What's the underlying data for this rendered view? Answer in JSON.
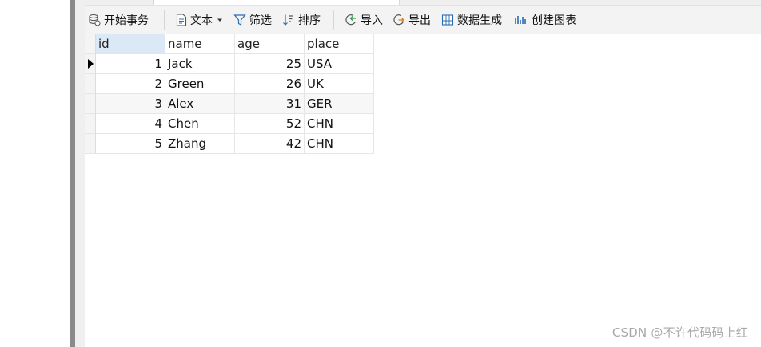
{
  "toolbar": {
    "begin_transaction": "开始事务",
    "text": "文本",
    "filter": "筛选",
    "sort": "排序",
    "import": "导入",
    "export": "导出",
    "data_generation": "数据生成",
    "create_chart": "创建图表"
  },
  "table": {
    "columns": [
      "id",
      "name",
      "age",
      "place"
    ],
    "rows": [
      {
        "id": "1",
        "name": "Jack",
        "age": "25",
        "place": "USA"
      },
      {
        "id": "2",
        "name": "Green",
        "age": "26",
        "place": "UK"
      },
      {
        "id": "3",
        "name": "Alex",
        "age": "31",
        "place": "GER"
      },
      {
        "id": "4",
        "name": "Chen",
        "age": "52",
        "place": "CHN"
      },
      {
        "id": "5",
        "name": "Zhang",
        "age": "42",
        "place": "CHN"
      }
    ]
  },
  "watermark": "CSDN @不许代码码上红",
  "colors": {
    "accent_blue": "#2b6cb0",
    "selected_header": "#dbe9f7",
    "toolbar_bg": "#f3f3f3"
  },
  "icons": [
    "database-transaction-icon",
    "text-document-icon",
    "dropdown-arrow-icon",
    "filter-funnel-icon",
    "sort-icon",
    "import-icon",
    "export-icon",
    "data-generation-icon",
    "chart-icon",
    "current-row-arrow-icon"
  ]
}
